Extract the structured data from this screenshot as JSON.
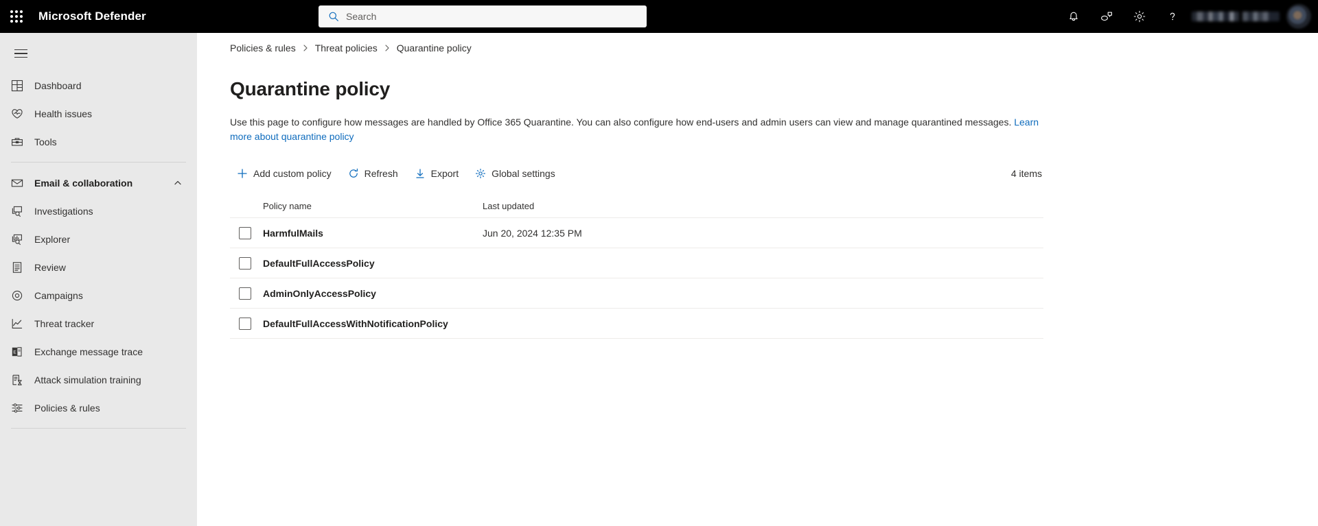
{
  "header": {
    "brand": "Microsoft Defender",
    "waffle_label": "app-launcher",
    "search": {
      "placeholder": "Search",
      "value": ""
    },
    "icons": [
      {
        "name": "notifications-bell-icon",
        "title": "Notifications"
      },
      {
        "name": "feedback-icon",
        "title": "Feedback"
      },
      {
        "name": "settings-gear-icon",
        "title": "Settings"
      },
      {
        "name": "help-question-icon",
        "title": "Help"
      }
    ],
    "account_name": "",
    "avatar_label": "account-avatar"
  },
  "sidebar": {
    "hamburger_label": "Show navigation",
    "groups": [
      {
        "items": [
          {
            "label": "Dashboard",
            "icon": "dashboard-icon",
            "bold": false,
            "expandable": false
          },
          {
            "label": "Health issues",
            "icon": "heart-pulse-icon",
            "bold": false,
            "expandable": false
          },
          {
            "label": "Tools",
            "icon": "toolbox-icon",
            "bold": false,
            "expandable": false
          }
        ]
      },
      {
        "items": [
          {
            "label": "Email & collaboration",
            "icon": "mail-icon",
            "bold": true,
            "expandable": true
          },
          {
            "label": "Investigations",
            "icon": "investigations-icon",
            "bold": false,
            "expandable": false
          },
          {
            "label": "Explorer",
            "icon": "explorer-icon",
            "bold": false,
            "expandable": false
          },
          {
            "label": "Review",
            "icon": "review-list-icon",
            "bold": false,
            "expandable": false
          },
          {
            "label": "Campaigns",
            "icon": "campaigns-target-icon",
            "bold": false,
            "expandable": false
          },
          {
            "label": "Threat tracker",
            "icon": "threat-tracker-chart-icon",
            "bold": false,
            "expandable": false
          },
          {
            "label": "Exchange message trace",
            "icon": "exchange-icon",
            "bold": false,
            "expandable": false
          },
          {
            "label": "Attack simulation training",
            "icon": "attack-simulation-icon",
            "bold": false,
            "expandable": false
          },
          {
            "label": "Policies & rules",
            "icon": "policies-rules-sliders-icon",
            "bold": false,
            "expandable": false
          }
        ]
      }
    ]
  },
  "breadcrumb": [
    {
      "label": "Policies & rules"
    },
    {
      "label": "Threat policies"
    },
    {
      "label": "Quarantine policy"
    }
  ],
  "page": {
    "title": "Quarantine policy",
    "description_text": "Use this page to configure how messages are handled by Office 365 Quarantine. You can also configure how end-users and admin users can view and manage quarantined messages. ",
    "description_link": "Learn more about quarantine policy"
  },
  "toolbar": {
    "add_custom_policy": "Add custom policy",
    "refresh": "Refresh",
    "export": "Export",
    "global_settings": "Global settings",
    "items_count": "4 items"
  },
  "table": {
    "columns": {
      "policy_name": "Policy name",
      "last_updated": "Last updated"
    },
    "rows": [
      {
        "name": "HarmfulMails",
        "last_updated": "Jun 20, 2024 12:35 PM",
        "checked": false
      },
      {
        "name": "DefaultFullAccessPolicy",
        "last_updated": "",
        "checked": false
      },
      {
        "name": "AdminOnlyAccessPolicy",
        "last_updated": "",
        "checked": false
      },
      {
        "name": "DefaultFullAccessWithNotificationPolicy",
        "last_updated": "",
        "checked": false
      }
    ]
  },
  "colors": {
    "header_bg": "#000000",
    "sidebar_bg": "#e9e9e9",
    "content_bg": "#ffffff",
    "accent_blue": "#0f6cbd",
    "text_primary": "#201f1e",
    "divider": "#edebe9"
  }
}
